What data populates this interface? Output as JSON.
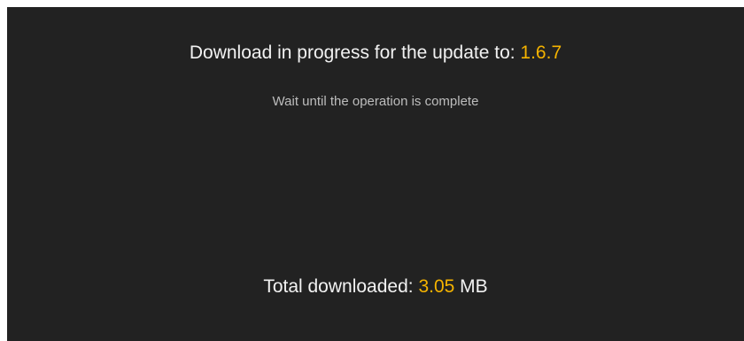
{
  "colors": {
    "background": "#222222",
    "text": "#f2f2f2",
    "muted_text": "#bdbdbd",
    "accent": "#f5b300"
  },
  "update": {
    "title_prefix": "Download in progress for the update to: ",
    "version": "1.6.7",
    "subtitle": "Wait until the operation is complete"
  },
  "download": {
    "total_label": "Total downloaded: ",
    "amount": "3.05",
    "unit": " MB"
  }
}
